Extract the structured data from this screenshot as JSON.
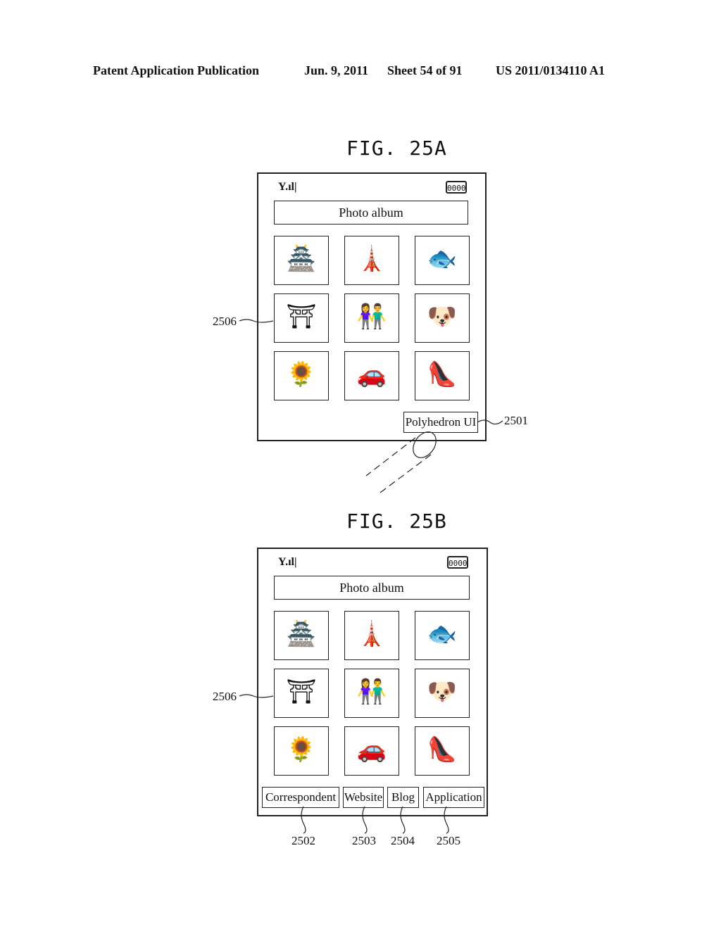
{
  "header": {
    "left": "Patent Application Publication",
    "date": "Jun. 9, 2011",
    "sheet": "Sheet 54 of 91",
    "number": "US 2011/0134110 A1"
  },
  "figures": [
    {
      "label": "FIG. 25A",
      "signal": "Y.ıl|",
      "battery": "0000",
      "title": "Photo album",
      "thumbnails": [
        "palace",
        "eiffel-tower",
        "fish",
        "arch-tourist",
        "couple",
        "puppy",
        "flowers",
        "car",
        "shoe"
      ],
      "thumb_glyphs": [
        "🏯",
        "🗼",
        "🐟",
        "⛩",
        "👫",
        "🐶",
        "🌻",
        "🚗",
        "👠"
      ],
      "button": "Polyhedron UI",
      "refs": {
        "button": "2501",
        "thumb": "2506"
      }
    },
    {
      "label": "FIG. 25B",
      "signal": "Y.ıl|",
      "battery": "0000",
      "title": "Photo album",
      "thumbnails": [
        "palace",
        "eiffel-tower",
        "fish",
        "arch-tourist",
        "couple",
        "puppy",
        "flowers",
        "car",
        "shoe"
      ],
      "thumb_glyphs": [
        "🏯",
        "🗼",
        "🐟",
        "⛩",
        "👫",
        "🐶",
        "🌻",
        "🚗",
        "👠"
      ],
      "buttons": [
        "Correspondent",
        "Website",
        "Blog",
        "Application"
      ],
      "refs": {
        "thumb": "2506",
        "buttons": [
          "2502",
          "2503",
          "2504",
          "2505"
        ]
      }
    }
  ]
}
